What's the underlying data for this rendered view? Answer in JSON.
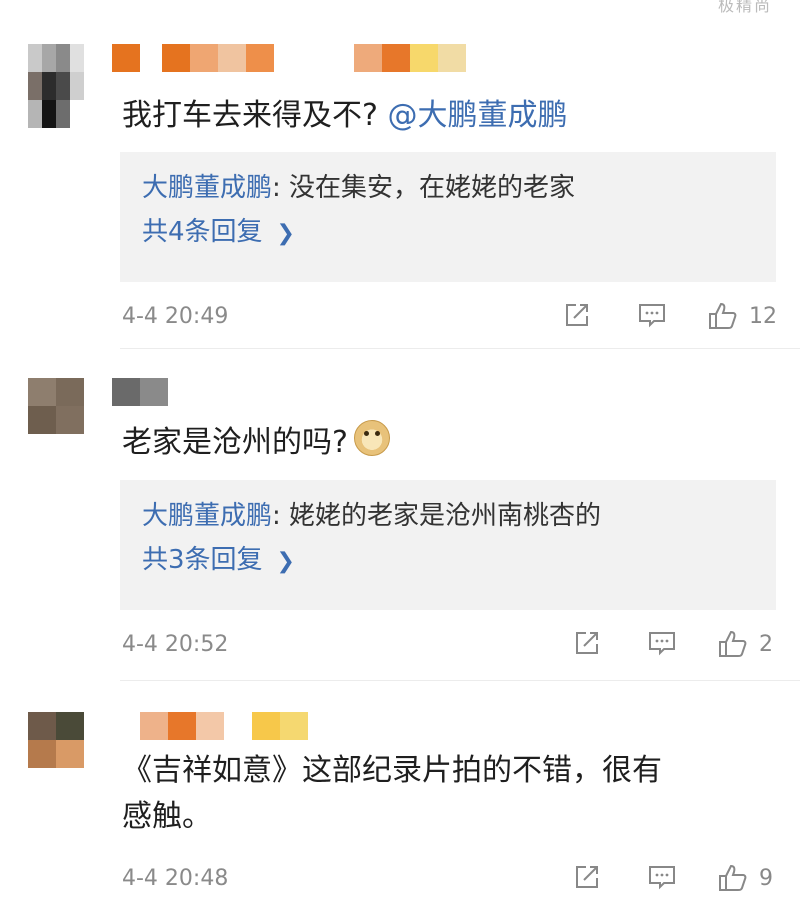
{
  "top_fragment": "极精尚",
  "comments": [
    {
      "text": "我打车去来得及不?",
      "mention": "@大鹏董成鹏",
      "reply_user": "大鹏董成鹏",
      "reply_text": ": 没在集安，在姥姥的老家",
      "reply_more": "共4条回复",
      "timestamp": "4-4 20:49",
      "likes": "12"
    },
    {
      "text": "老家是沧州的吗?",
      "emoji": "doge-emoji",
      "reply_user": "大鹏董成鹏",
      "reply_text": ": 姥姥的老家是沧州南桃杏的",
      "reply_more": "共3条回复",
      "timestamp": "4-4 20:52",
      "likes": "2"
    },
    {
      "text_line1": "《吉祥如意》这部纪录片拍的不错，很有",
      "text_line2": "感触。",
      "timestamp": "4-4 20:48",
      "likes": "9"
    }
  ],
  "icons": {
    "share": "share-icon",
    "reply": "comment-icon",
    "like": "thumbs-up-icon",
    "chevron": "chevron-right-icon"
  },
  "colors": {
    "link": "#3d6db1",
    "reply_bg": "#f2f2f2",
    "meta": "#8a8a8a"
  }
}
